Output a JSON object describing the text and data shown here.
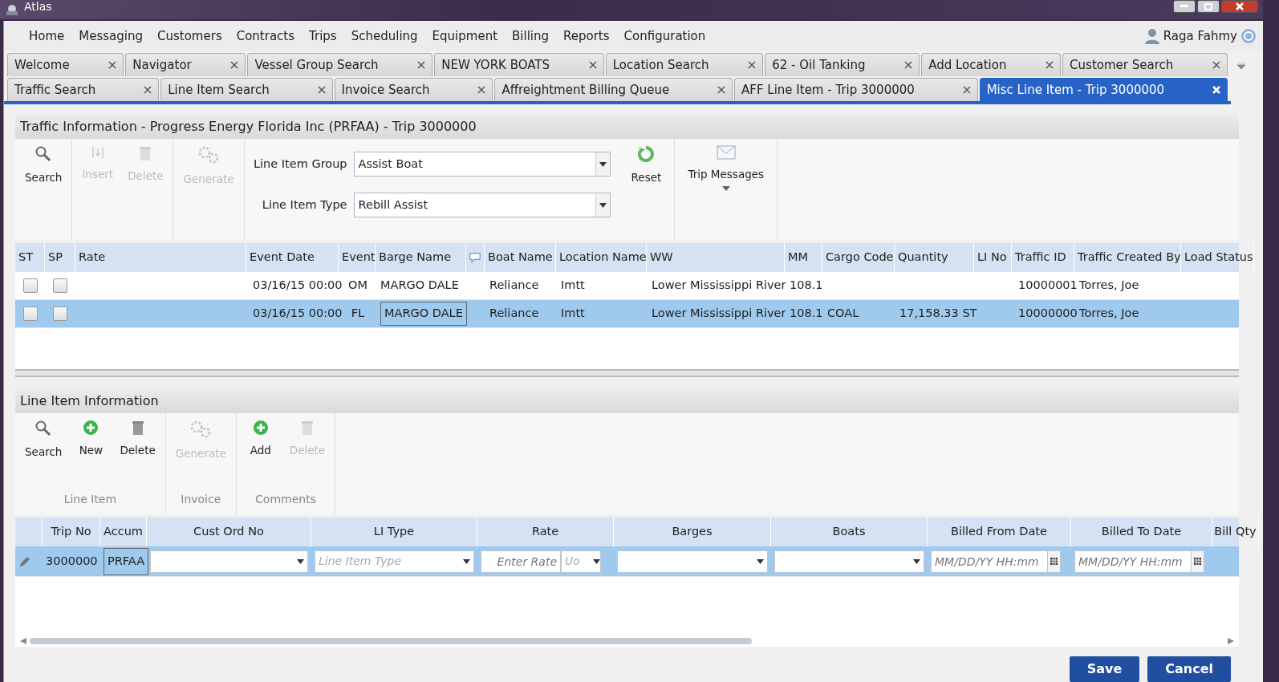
{
  "window": {
    "title": "Atlas"
  },
  "menu": [
    "Home",
    "Messaging",
    "Customers",
    "Contracts",
    "Trips",
    "Scheduling",
    "Equipment",
    "Billing",
    "Reports",
    "Configuration"
  ],
  "user": {
    "name": "Raga Fahmy"
  },
  "tab_rows": [
    [
      {
        "label": "Welcome",
        "selected": false
      },
      {
        "label": "Navigator",
        "selected": false
      },
      {
        "label": "Vessel Group Search",
        "selected": false
      },
      {
        "label": "NEW YORK BOATS",
        "selected": false
      },
      {
        "label": "Location Search",
        "selected": false
      },
      {
        "label": "62 - Oil Tanking",
        "selected": false
      },
      {
        "label": "Add Location",
        "selected": false
      },
      {
        "label": "Customer Search",
        "selected": false
      }
    ],
    [
      {
        "label": "Traffic Search",
        "selected": false
      },
      {
        "label": "Line Item Search",
        "selected": false
      },
      {
        "label": "Invoice Search",
        "selected": false
      },
      {
        "label": "Affreightment Billing Queue",
        "selected": false
      },
      {
        "label": "AFF Line Item - Trip 3000000",
        "selected": false
      },
      {
        "label": "Misc Line Item - Trip 3000000",
        "selected": true
      }
    ]
  ],
  "traffic": {
    "title": "Traffic Information - Progress Energy Florida Inc (PRFAA) - Trip 3000000",
    "toolbar": [
      [
        {
          "label": "Search",
          "kind": "search",
          "disabled": false
        }
      ],
      [
        {
          "label": "Insert",
          "kind": "insert",
          "disabled": true
        },
        {
          "label": "Delete",
          "kind": "trash",
          "disabled": true
        }
      ],
      [
        {
          "label": "Generate",
          "kind": "gears",
          "disabled": true
        }
      ]
    ],
    "fields": [
      {
        "label": "Line Item Group",
        "value": "Assist Boat"
      },
      {
        "label": "Line Item Type",
        "value": "Rebill Assist"
      }
    ],
    "tools_after": [
      {
        "label": "Reset",
        "kind": "reset",
        "disabled": false
      },
      {
        "label": "Trip Messages",
        "kind": "mail",
        "disabled": false
      }
    ],
    "table": {
      "columns": [
        "ST",
        "SP",
        "Rate",
        "Event Date",
        "Event",
        "Barge Name",
        {
          "kind": "comment"
        },
        "Boat Name",
        "Location Name",
        "WW",
        "MM",
        "Cargo Code",
        "Quantity",
        "LI No",
        "Traffic ID",
        "Traffic Created By",
        "Load Status"
      ],
      "rows": [
        {
          "selected": false,
          "st_checked": false,
          "sp_checked": false,
          "barge_focused": false,
          "cells": [
            "",
            "",
            "",
            "03/16/15 00:00",
            "OM",
            "MARGO DALE",
            "",
            "Reliance",
            "Imtt",
            "Lower Mississippi River",
            "108.1",
            "",
            "",
            "",
            "10000001",
            "Torres, Joe",
            ""
          ]
        },
        {
          "selected": true,
          "st_checked": false,
          "sp_checked": false,
          "barge_focused": true,
          "cells": [
            "",
            "",
            "",
            "03/16/15 00:00",
            "FL",
            "MARGO DALE",
            "",
            "Reliance",
            "Imtt",
            "Lower Mississippi River",
            "108.1",
            "COAL",
            "17,158.33 ST",
            "",
            "10000000",
            "Torres, Joe",
            ""
          ]
        }
      ]
    }
  },
  "line_item": {
    "title": "Line Item Information",
    "groups": [
      {
        "label": "Line Item",
        "buttons": [
          {
            "label": "Search",
            "kind": "search",
            "disabled": false
          },
          {
            "label": "New",
            "kind": "plus",
            "disabled": false
          },
          {
            "label": "Delete",
            "kind": "trash",
            "disabled": false
          }
        ]
      },
      {
        "label": "Invoice",
        "buttons": [
          {
            "label": "Generate",
            "kind": "gears",
            "disabled": true
          }
        ]
      },
      {
        "label": "Comments",
        "buttons": [
          {
            "label": "Add",
            "kind": "plus",
            "disabled": false
          },
          {
            "label": "Delete",
            "kind": "trash",
            "disabled": true
          }
        ]
      }
    ],
    "grid": {
      "columns": [
        "",
        "Trip No",
        "Accum",
        "Cust Ord No",
        "LI Type",
        "Rate",
        "Barges",
        "Boats",
        "Billed From Date",
        "Billed To Date",
        "Bill Qty"
      ],
      "row": {
        "selected": true,
        "trip_no": "3000000",
        "accum": "PRFAA",
        "cust_ord_no": {
          "kind": "combo"
        },
        "li_type": {
          "kind": "combo",
          "placeholder": "Line Item Type"
        },
        "rate": {
          "placeholder": "Enter Rate",
          "unit": "Uo"
        },
        "barges": {
          "kind": "combo"
        },
        "boats": {
          "kind": "combo"
        },
        "billed_from": {
          "placeholder": "MM/DD/YY HH:mm"
        },
        "billed_to": {
          "placeholder": "MM/DD/YY HH:mm"
        }
      }
    }
  },
  "buttons": [
    {
      "label": "Save"
    },
    {
      "label": "Cancel"
    }
  ]
}
